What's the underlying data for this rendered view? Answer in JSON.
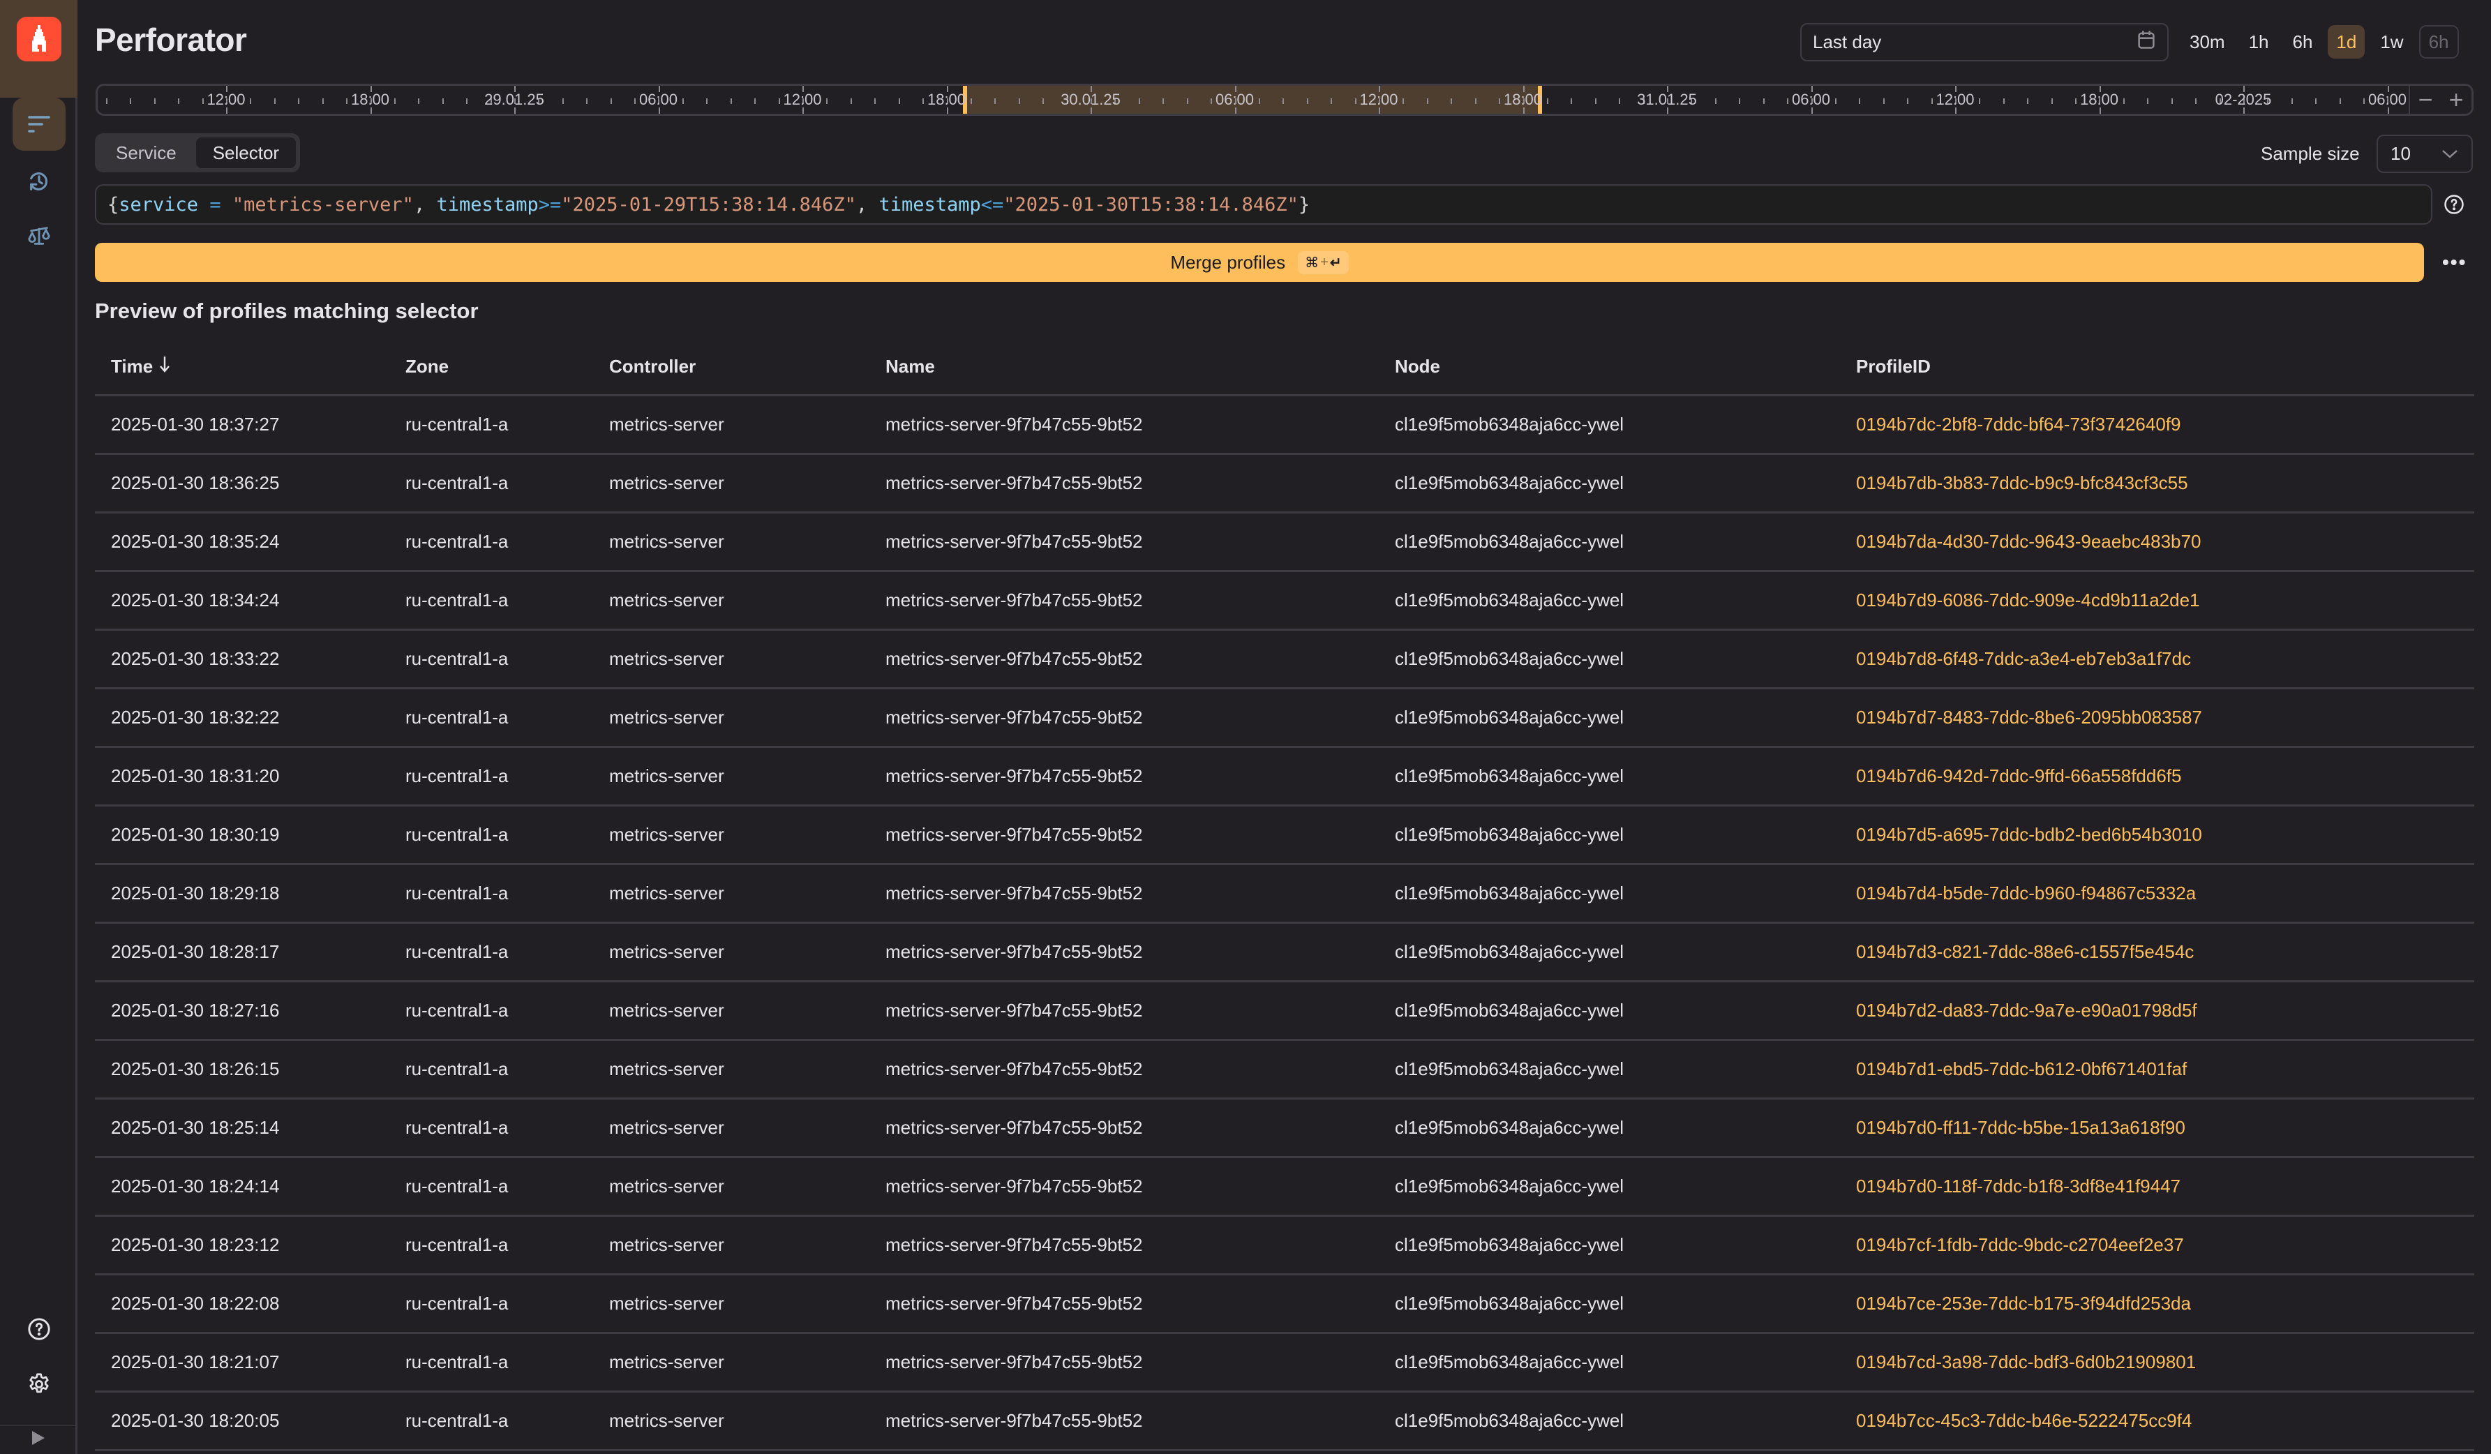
{
  "app": {
    "title": "Perforator"
  },
  "sidebar": {
    "logo_icon": "flame-logo-icon",
    "items": [
      {
        "name": "profiles",
        "icon": "filter-lines-icon",
        "active": true
      },
      {
        "name": "history",
        "icon": "history-icon",
        "active": false
      },
      {
        "name": "compare",
        "icon": "scales-icon",
        "active": false
      }
    ],
    "bottom": [
      {
        "name": "help",
        "icon": "help-circle-icon"
      },
      {
        "name": "settings",
        "icon": "gear-icon"
      }
    ],
    "expand_icon": "play-triangle-icon"
  },
  "time_range": {
    "input_value": "Last day",
    "calendar_icon": "calendar-icon",
    "presets": [
      {
        "label": "30m",
        "state": "normal"
      },
      {
        "label": "1h",
        "state": "normal"
      },
      {
        "label": "6h",
        "state": "normal"
      },
      {
        "label": "1d",
        "state": "active"
      },
      {
        "label": "1w",
        "state": "normal"
      },
      {
        "label": "6h",
        "state": "outlined"
      }
    ]
  },
  "timeline": {
    "labels": [
      "12:00",
      "18:00",
      "29.01.25",
      "06:00",
      "12:00",
      "18:00",
      "30.01.25",
      "06:00",
      "12:00",
      "18:00",
      "31.01.25",
      "06:00",
      "12:00",
      "18:00",
      "02-2025",
      "06:00"
    ],
    "selection_start_label_index": 5,
    "selection_end_label_index": 9,
    "zoom_out_label": "−",
    "zoom_in_label": "+"
  },
  "mode_tabs": {
    "items": [
      {
        "label": "Service",
        "active": false
      },
      {
        "label": "Selector",
        "active": true
      }
    ]
  },
  "sample_size": {
    "label": "Sample size",
    "value": "10"
  },
  "selector": {
    "value": "{service = \"metrics-server\", timestamp>=\"2025-01-29T15:38:14.846Z\", timestamp<=\"2025-01-30T15:38:14.846Z\"}",
    "tokens": [
      {
        "t": "{",
        "c": "brace"
      },
      {
        "t": "service",
        "c": "key"
      },
      {
        "t": " = ",
        "c": "op"
      },
      {
        "t": "\"metrics-server\"",
        "c": "str"
      },
      {
        "t": ", ",
        "c": "punc"
      },
      {
        "t": "timestamp",
        "c": "key"
      },
      {
        "t": ">=",
        "c": "op"
      },
      {
        "t": "\"2025-01-29T15:38:14.846Z\"",
        "c": "str"
      },
      {
        "t": ", ",
        "c": "punc"
      },
      {
        "t": "timestamp",
        "c": "key"
      },
      {
        "t": "<=",
        "c": "op"
      },
      {
        "t": "\"2025-01-30T15:38:14.846Z\"",
        "c": "str"
      },
      {
        "t": "}",
        "c": "brace"
      }
    ]
  },
  "merge": {
    "label": "Merge profiles",
    "shortcut_cmd": "⌘",
    "shortcut_plus": "+",
    "shortcut_enter": "↵",
    "more_label": "•••"
  },
  "colors": {
    "accent": "#ffbe5c",
    "accent_bg": "#4d3e2f",
    "background": "#221f24",
    "logo": "#ff4d33"
  },
  "preview": {
    "title": "Preview of profiles matching selector",
    "columns": [
      {
        "label": "Time",
        "sort": "desc"
      },
      {
        "label": "Zone"
      },
      {
        "label": "Controller"
      },
      {
        "label": "Name"
      },
      {
        "label": "Node"
      },
      {
        "label": "ProfileID"
      }
    ],
    "rows": [
      {
        "time": "2025-01-30 18:37:27",
        "zone": "ru-central1-a",
        "controller": "metrics-server",
        "name": "metrics-server-9f7b47c55-9bt52",
        "node": "cl1e9f5mob6348aja6cc-ywel",
        "profile_id": "0194b7dc-2bf8-7ddc-bf64-73f3742640f9"
      },
      {
        "time": "2025-01-30 18:36:25",
        "zone": "ru-central1-a",
        "controller": "metrics-server",
        "name": "metrics-server-9f7b47c55-9bt52",
        "node": "cl1e9f5mob6348aja6cc-ywel",
        "profile_id": "0194b7db-3b83-7ddc-b9c9-bfc843cf3c55"
      },
      {
        "time": "2025-01-30 18:35:24",
        "zone": "ru-central1-a",
        "controller": "metrics-server",
        "name": "metrics-server-9f7b47c55-9bt52",
        "node": "cl1e9f5mob6348aja6cc-ywel",
        "profile_id": "0194b7da-4d30-7ddc-9643-9eaebc483b70"
      },
      {
        "time": "2025-01-30 18:34:24",
        "zone": "ru-central1-a",
        "controller": "metrics-server",
        "name": "metrics-server-9f7b47c55-9bt52",
        "node": "cl1e9f5mob6348aja6cc-ywel",
        "profile_id": "0194b7d9-6086-7ddc-909e-4cd9b11a2de1"
      },
      {
        "time": "2025-01-30 18:33:22",
        "zone": "ru-central1-a",
        "controller": "metrics-server",
        "name": "metrics-server-9f7b47c55-9bt52",
        "node": "cl1e9f5mob6348aja6cc-ywel",
        "profile_id": "0194b7d8-6f48-7ddc-a3e4-eb7eb3a1f7dc"
      },
      {
        "time": "2025-01-30 18:32:22",
        "zone": "ru-central1-a",
        "controller": "metrics-server",
        "name": "metrics-server-9f7b47c55-9bt52",
        "node": "cl1e9f5mob6348aja6cc-ywel",
        "profile_id": "0194b7d7-8483-7ddc-8be6-2095bb083587"
      },
      {
        "time": "2025-01-30 18:31:20",
        "zone": "ru-central1-a",
        "controller": "metrics-server",
        "name": "metrics-server-9f7b47c55-9bt52",
        "node": "cl1e9f5mob6348aja6cc-ywel",
        "profile_id": "0194b7d6-942d-7ddc-9ffd-66a558fdd6f5"
      },
      {
        "time": "2025-01-30 18:30:19",
        "zone": "ru-central1-a",
        "controller": "metrics-server",
        "name": "metrics-server-9f7b47c55-9bt52",
        "node": "cl1e9f5mob6348aja6cc-ywel",
        "profile_id": "0194b7d5-a695-7ddc-bdb2-bed6b54b3010"
      },
      {
        "time": "2025-01-30 18:29:18",
        "zone": "ru-central1-a",
        "controller": "metrics-server",
        "name": "metrics-server-9f7b47c55-9bt52",
        "node": "cl1e9f5mob6348aja6cc-ywel",
        "profile_id": "0194b7d4-b5de-7ddc-b960-f94867c5332a"
      },
      {
        "time": "2025-01-30 18:28:17",
        "zone": "ru-central1-a",
        "controller": "metrics-server",
        "name": "metrics-server-9f7b47c55-9bt52",
        "node": "cl1e9f5mob6348aja6cc-ywel",
        "profile_id": "0194b7d3-c821-7ddc-88e6-c1557f5e454c"
      },
      {
        "time": "2025-01-30 18:27:16",
        "zone": "ru-central1-a",
        "controller": "metrics-server",
        "name": "metrics-server-9f7b47c55-9bt52",
        "node": "cl1e9f5mob6348aja6cc-ywel",
        "profile_id": "0194b7d2-da83-7ddc-9a7e-e90a01798d5f"
      },
      {
        "time": "2025-01-30 18:26:15",
        "zone": "ru-central1-a",
        "controller": "metrics-server",
        "name": "metrics-server-9f7b47c55-9bt52",
        "node": "cl1e9f5mob6348aja6cc-ywel",
        "profile_id": "0194b7d1-ebd5-7ddc-b612-0bf671401faf"
      },
      {
        "time": "2025-01-30 18:25:14",
        "zone": "ru-central1-a",
        "controller": "metrics-server",
        "name": "metrics-server-9f7b47c55-9bt52",
        "node": "cl1e9f5mob6348aja6cc-ywel",
        "profile_id": "0194b7d0-ff11-7ddc-b5be-15a13a618f90"
      },
      {
        "time": "2025-01-30 18:24:14",
        "zone": "ru-central1-a",
        "controller": "metrics-server",
        "name": "metrics-server-9f7b47c55-9bt52",
        "node": "cl1e9f5mob6348aja6cc-ywel",
        "profile_id": "0194b7d0-118f-7ddc-b1f8-3df8e41f9447"
      },
      {
        "time": "2025-01-30 18:23:12",
        "zone": "ru-central1-a",
        "controller": "metrics-server",
        "name": "metrics-server-9f7b47c55-9bt52",
        "node": "cl1e9f5mob6348aja6cc-ywel",
        "profile_id": "0194b7cf-1fdb-7ddc-9bdc-c2704eef2e37"
      },
      {
        "time": "2025-01-30 18:22:08",
        "zone": "ru-central1-a",
        "controller": "metrics-server",
        "name": "metrics-server-9f7b47c55-9bt52",
        "node": "cl1e9f5mob6348aja6cc-ywel",
        "profile_id": "0194b7ce-253e-7ddc-b175-3f94dfd253da"
      },
      {
        "time": "2025-01-30 18:21:07",
        "zone": "ru-central1-a",
        "controller": "metrics-server",
        "name": "metrics-server-9f7b47c55-9bt52",
        "node": "cl1e9f5mob6348aja6cc-ywel",
        "profile_id": "0194b7cd-3a98-7ddc-bdf3-6d0b21909801"
      },
      {
        "time": "2025-01-30 18:20:05",
        "zone": "ru-central1-a",
        "controller": "metrics-server",
        "name": "metrics-server-9f7b47c55-9bt52",
        "node": "cl1e9f5mob6348aja6cc-ywel",
        "profile_id": "0194b7cc-45c3-7ddc-b46e-5222475cc9f4"
      }
    ]
  }
}
